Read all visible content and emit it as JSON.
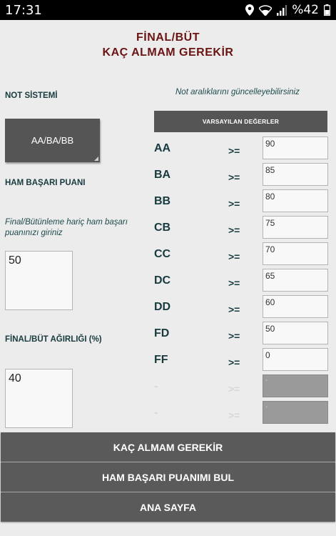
{
  "status_bar": {
    "time": "17:31",
    "battery": "%42"
  },
  "header": {
    "line1": "FİNAL/BÜT",
    "line2": "KAÇ ALMAM GEREKİR"
  },
  "left": {
    "not_sistemi_label": "NOT SİSTEMİ",
    "system_value": "AA/BA/BB",
    "ham_label": "HAM BAŞARI PUANI",
    "ham_hint": "Final/Bütünleme hariç ham başarı puanınızı giriniz",
    "ham_value": "50",
    "weight_label": "FİNAL/BÜT AĞIRLIĞI (%)",
    "weight_value": "40"
  },
  "right": {
    "hint": "Not aralıklarını güncelleyebilirsiniz",
    "defaults_button": "VARSAYILAN DEĞERLER",
    "operator": ">=",
    "grades": [
      {
        "letter": "AA",
        "value": "90"
      },
      {
        "letter": "BA",
        "value": "85"
      },
      {
        "letter": "BB",
        "value": "80"
      },
      {
        "letter": "CB",
        "value": "75"
      },
      {
        "letter": "CC",
        "value": "70"
      },
      {
        "letter": "DC",
        "value": "65"
      },
      {
        "letter": "DD",
        "value": "60"
      },
      {
        "letter": "FD",
        "value": "50"
      },
      {
        "letter": "FF",
        "value": "0"
      }
    ],
    "disabled_rows": [
      {
        "letter": "-",
        "operator": ">=",
        "value": "-"
      },
      {
        "letter": "-",
        "operator": ">=",
        "value": "-"
      }
    ]
  },
  "buttons": {
    "calc": "KAÇ ALMAM GEREKİR",
    "find": "HAM BAŞARI PUANIMI BUL",
    "home": "ANA SAYFA"
  },
  "colors": {
    "title": "#6a1414",
    "label": "#173a3e",
    "button": "#555555"
  },
  "icons": [
    "location-icon",
    "wifi-icon",
    "signal-icon",
    "battery-icon"
  ]
}
